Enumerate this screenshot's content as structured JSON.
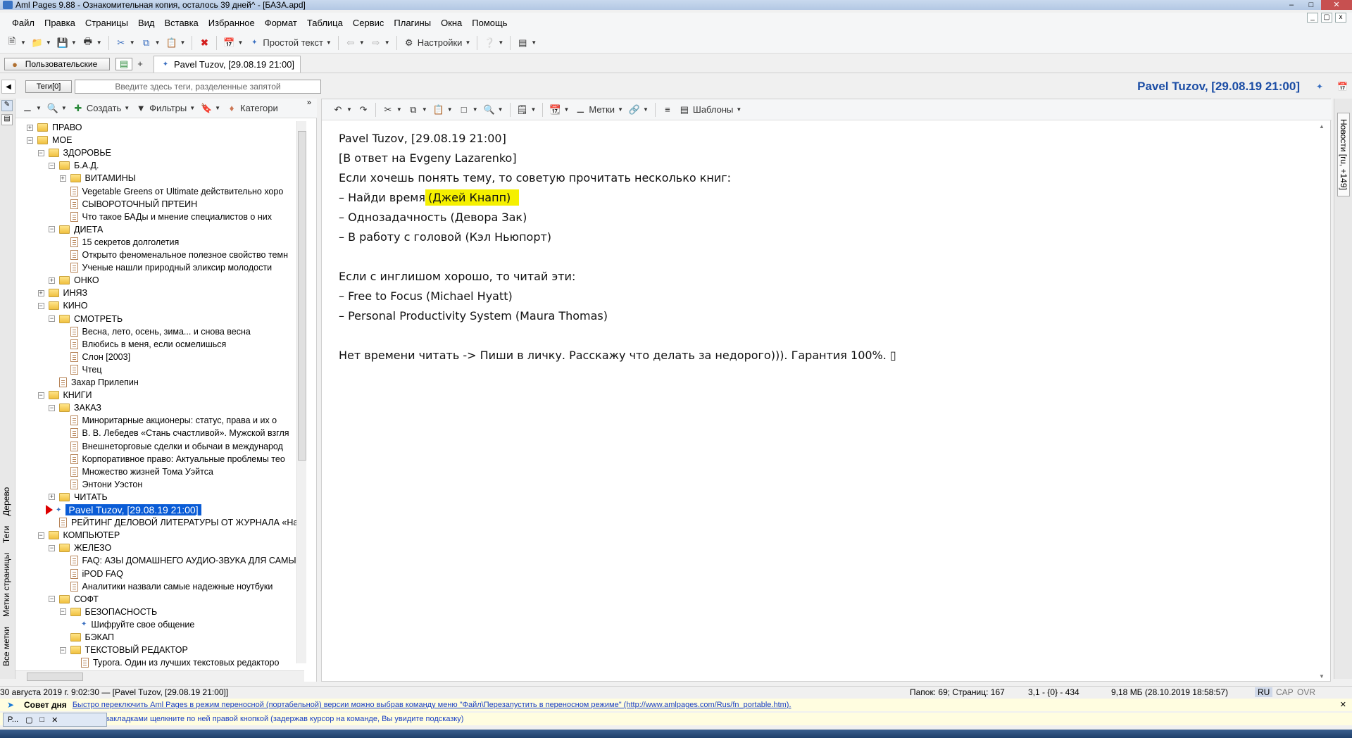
{
  "window": {
    "title": "Aml Pages 9.88 - Ознакомительная копия, осталось 39 дней^ - [БАЗА.apd]"
  },
  "menu": [
    "Файл",
    "Правка",
    "Страницы",
    "Вид",
    "Вставка",
    "Избранное",
    "Формат",
    "Таблица",
    "Сервис",
    "Плагины",
    "Окна",
    "Помощь"
  ],
  "toolbar": {
    "plain_text": "Простой текст",
    "settings": "Настройки"
  },
  "tabs": {
    "user_button": "Пользовательские",
    "add": "+",
    "doc_tab": "Pavel Tuzov, [29.08.19 21:00]"
  },
  "tagbar": {
    "tags_button": "Теги[0]",
    "tags_placeholder": "Введите здесь теги, разделенные запятой"
  },
  "doc_title": "Pavel Tuzov, [29.08.19 21:00]",
  "tree_toolbar": {
    "create": "Создать",
    "filters": "Фильтры",
    "categories": "Категори"
  },
  "left_vertical_tabs": [
    "Все метки",
    "Метки страницы",
    "Теги",
    "Дерево"
  ],
  "tree": [
    {
      "label": "ПРАВО",
      "level": 0,
      "type": "folder",
      "exp": "+"
    },
    {
      "label": "МОЕ",
      "level": 0,
      "type": "folder",
      "exp": "-"
    },
    {
      "label": "ЗДОРОВЬЕ",
      "level": 1,
      "type": "folder",
      "exp": "-"
    },
    {
      "label": "Б.А.Д.",
      "level": 2,
      "type": "folder",
      "exp": "-"
    },
    {
      "label": "ВИТАМИНЫ",
      "level": 3,
      "type": "folder",
      "exp": "+"
    },
    {
      "label": "Vegetable Greens от Ultimate действительно хоро",
      "level": 3,
      "type": "page"
    },
    {
      "label": "СЫВОРОТОЧНЫЙ ПРТЕИН",
      "level": 3,
      "type": "page"
    },
    {
      "label": "Что такое БАДы и мнение специалистов о них",
      "level": 3,
      "type": "page"
    },
    {
      "label": "ДИЕТА",
      "level": 2,
      "type": "folder",
      "exp": "-"
    },
    {
      "label": "15 секретов долголетия",
      "level": 3,
      "type": "page"
    },
    {
      "label": "Открыто феноменальное полезное свойство темн",
      "level": 3,
      "type": "page"
    },
    {
      "label": "Ученые нашли природный эликсир молодости",
      "level": 3,
      "type": "page"
    },
    {
      "label": "ОНКО",
      "level": 2,
      "type": "folder",
      "exp": "+"
    },
    {
      "label": "ИНЯЗ",
      "level": 1,
      "type": "folder",
      "exp": "+"
    },
    {
      "label": "КИНО",
      "level": 1,
      "type": "folder",
      "exp": "-"
    },
    {
      "label": "СМОТРЕТЬ",
      "level": 2,
      "type": "folder",
      "exp": "-"
    },
    {
      "label": "Весна, лето, осень, зима... и снова весна",
      "level": 3,
      "type": "page"
    },
    {
      "label": "Влюбись в меня, если осмелишься",
      "level": 3,
      "type": "page"
    },
    {
      "label": "Слон [2003]",
      "level": 3,
      "type": "page"
    },
    {
      "label": "Чтец",
      "level": 3,
      "type": "page"
    },
    {
      "label": "Захар Прилепин",
      "level": 2,
      "type": "page"
    },
    {
      "label": "КНИГИ",
      "level": 1,
      "type": "folder",
      "exp": "-"
    },
    {
      "label": "ЗАКАЗ",
      "level": 2,
      "type": "folder",
      "exp": "-"
    },
    {
      "label": "Миноритарные акционеры: статус, права и их о",
      "level": 3,
      "type": "page"
    },
    {
      "label": "В. В. Лебедев «Стань счастливой». Мужской взгля",
      "level": 3,
      "type": "page"
    },
    {
      "label": "Внешнеторговые сделки и обычаи в международ",
      "level": 3,
      "type": "page"
    },
    {
      "label": "Корпоративное право: Актуальные проблемы тео",
      "level": 3,
      "type": "page"
    },
    {
      "label": "Множество жизней Тома Уэйтса",
      "level": 3,
      "type": "page"
    },
    {
      "label": "Энтони Уэстон",
      "level": 3,
      "type": "page"
    },
    {
      "label": "ЧИТАТЬ",
      "level": 2,
      "type": "folder",
      "exp": "+"
    },
    {
      "label": "Pavel Tuzov, [29.08.19 21:00]",
      "level": 2,
      "type": "selected"
    },
    {
      "label": "РЕЙТИНГ ДЕЛОВОЙ ЛИТЕРАТУРЫ ОТ ЖУРНАЛА «Harv",
      "level": 2,
      "type": "page"
    },
    {
      "label": "КОМПЬЮТЕР",
      "level": 1,
      "type": "folder",
      "exp": "-"
    },
    {
      "label": "ЖЕЛЕЗО",
      "level": 2,
      "type": "folder",
      "exp": "-"
    },
    {
      "label": "FAQ: АЗЫ ДОМАШНЕГО АУДИО-ЗВУКА ДЛЯ САМЫХ",
      "level": 3,
      "type": "page"
    },
    {
      "label": "iPOD FAQ",
      "level": 3,
      "type": "page"
    },
    {
      "label": "Аналитики назвали самые надежные ноутбуки",
      "level": 3,
      "type": "page"
    },
    {
      "label": "СОФТ",
      "level": 2,
      "type": "folder",
      "exp": "-"
    },
    {
      "label": "БЕЗОПАСНОСТЬ",
      "level": 3,
      "type": "folder",
      "exp": "-"
    },
    {
      "label": "Шифруйте свое общение",
      "level": 4,
      "type": "note"
    },
    {
      "label": "БЭКАП",
      "level": 3,
      "type": "folder",
      "exp": ""
    },
    {
      "label": "ТЕКСТОВЫЙ РЕДАКТОР",
      "level": 3,
      "type": "folder",
      "exp": "-"
    },
    {
      "label": "Typora. Один из лучших текстовых редакторо",
      "level": 4,
      "type": "page"
    }
  ],
  "editor_toolbar": {
    "labels": "Метки",
    "templates": "Шаблоны"
  },
  "content": {
    "lines": [
      "Pavel Tuzov, [29.08.19 21:00]",
      "[В ответ на Evgeny Lazarenko]",
      "Если хочешь понять тему, то советую прочитать несколько книг:",
      "",
      "– Однозадачность (Девора Зак)",
      "– В работу с головой (Кэл Ньюпорт)",
      "",
      "Если с инглишом хорошо, то читай эти:",
      "– Free to Focus (Michael Hyatt)",
      "– Personal Productivity System (Maura Thomas)",
      "",
      "Нет времени читать -> Пиши в личку. Расскажу что делать за недорого))). Гарантия 100%. ▯"
    ],
    "line4_prefix": "– Найди время",
    "line4_highlight": "(Джей Кнапп)"
  },
  "right_tab": "Новости [ru, +149]",
  "statusbar": {
    "left": "30 августа 2019 г. 9:02:30 — [Pavel Tuzov, [29.08.19 21:00]]",
    "folders": "Папок: 69; Страниц: 167",
    "position": "3,1 - {0} - 434",
    "size": "9,18 МБ (28.10.2019 18:58:57)",
    "lang": "RU",
    "cap": "CAP",
    "ovr": "OVR"
  },
  "tip": {
    "label": "Совет дня",
    "text": "Быстро переключить Aml Pages в режим переносной (портабельной) версии можно выбрав команду меню \"Файл\\Перезапустить в переносном режиме\" (http://www.amlpages.com/Rus/fn_portable.htm)."
  },
  "hint": "закладками щелкните по ней правой кнопкой (задержав курсор на команде, Вы увидите подсказку)",
  "mini_window": "P..."
}
